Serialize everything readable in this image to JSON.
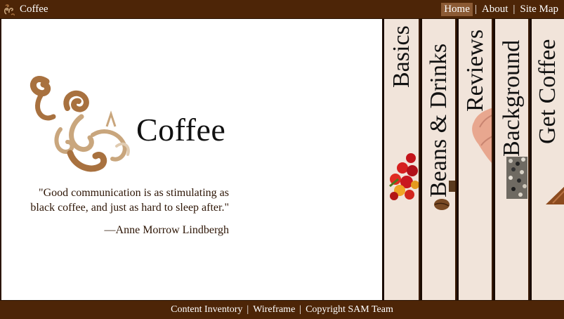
{
  "header": {
    "brand": "Coffee",
    "nav": [
      {
        "label": "Home",
        "active": true
      },
      {
        "label": "About",
        "active": false
      },
      {
        "label": "Site Map",
        "active": false
      }
    ],
    "separator": "|"
  },
  "hero": {
    "title": "Coffee",
    "quote": "\"Good communication is as stimulating as black coffee, and just as hard to sleep after.\"",
    "attribution": "—Anne Morrow Lindbergh"
  },
  "tabs": [
    {
      "label": "Basics",
      "art": "coffee-cherries-icon"
    },
    {
      "label": "Beans & Drinks",
      "art": "coffee-bean-icon"
    },
    {
      "label": "Reviews",
      "art": "hand-icon"
    },
    {
      "label": "Background",
      "art": "beans-texture-icon"
    },
    {
      "label": "Get Coffee",
      "art": "wood-icon"
    }
  ],
  "footer": {
    "links": [
      "Content Inventory",
      "Wireframe",
      "Copyright SAM Team"
    ],
    "separator": "|"
  },
  "colors": {
    "bar": "#4d2507",
    "tab_bg": "#f1e4da",
    "logo_brown": "#a8713f",
    "logo_light": "#c9a67d"
  }
}
